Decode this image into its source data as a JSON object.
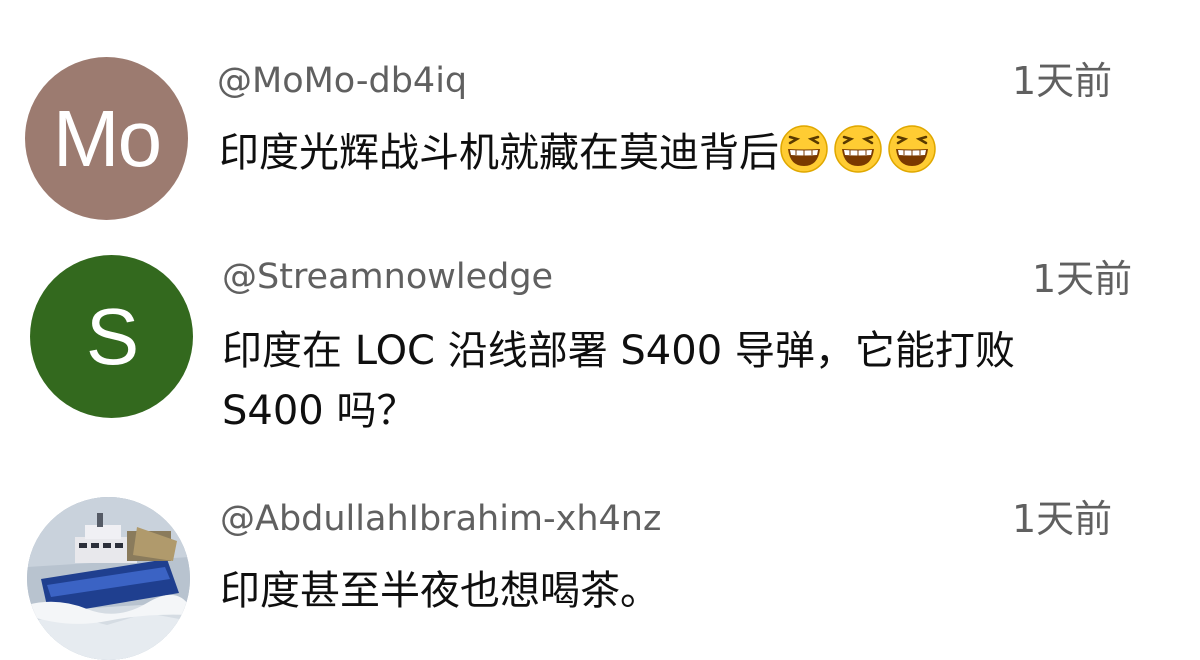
{
  "comments": [
    {
      "username": "@MoMo-db4iq",
      "time": "1天前",
      "avatar": {
        "letters": "Mo",
        "color": "#9c7b70"
      },
      "text": "印度光辉战斗机就藏在莫迪背后",
      "emoji": [
        "grinning-squinting-face-icon",
        "grinning-squinting-face-icon",
        "grinning-squinting-face-icon"
      ]
    },
    {
      "username": "@Streamnowledge",
      "time": "1天前",
      "avatar": {
        "letters": "S",
        "color": "#33691e"
      },
      "text_lines": [
        "印度在 LOC 沿线部署 S400 导弹，它能打败",
        "S400 吗？"
      ]
    },
    {
      "username": "@AbdullahIbrahim-xh4nz",
      "time": "1天前",
      "avatar": {
        "image": "ship-photo-avatar"
      },
      "text": "印度甚至半夜也想喝茶。"
    }
  ],
  "colors": {
    "meta_text": "#606060",
    "body_text": "#0f0f0f",
    "emoji_face": "#ffcc33"
  }
}
